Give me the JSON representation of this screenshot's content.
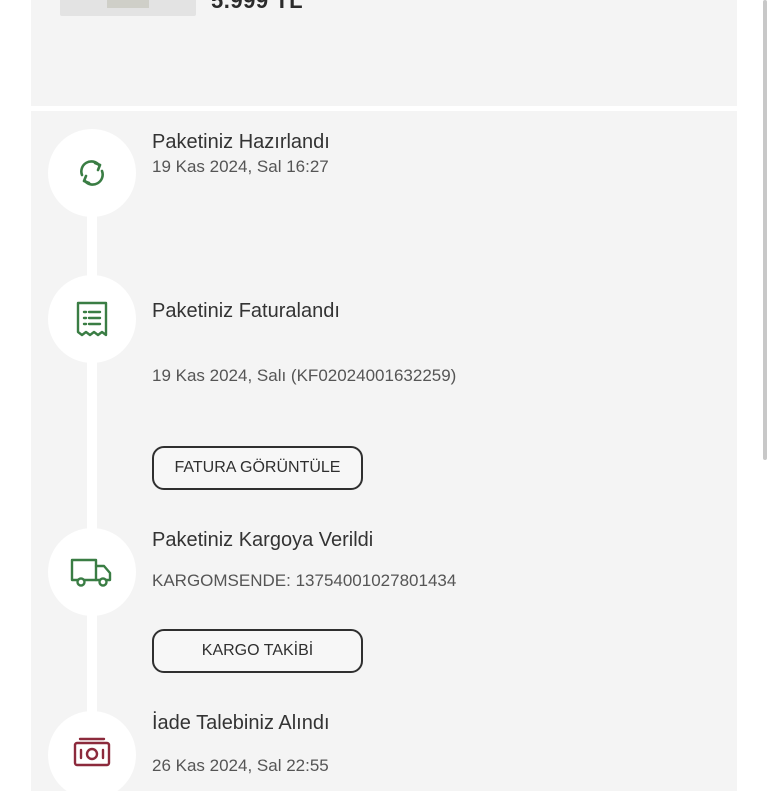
{
  "product": {
    "price": "5.999 TL"
  },
  "timeline": {
    "prepared": {
      "title": "Paketiniz Hazırlandı",
      "date": "19 Kas 2024, Sal 16:27"
    },
    "invoiced": {
      "title": "Paketiniz Faturalandı",
      "date": "19 Kas 2024, Salı (KF02024001632259)",
      "button": "FATURA GÖRÜNTÜLE"
    },
    "shipped": {
      "title": "Paketiniz Kargoya Verildi",
      "tracking": "KARGOMSENDE: 13754001027801434",
      "button": "KARGO TAKİBİ"
    },
    "return": {
      "title": "İade Talebiniz Alındı",
      "date": "26 Kas 2024, Sal 22:55"
    }
  },
  "colors": {
    "icon_green": "#3a7d44",
    "icon_return": "#8c2a3c",
    "text": "#333333"
  }
}
